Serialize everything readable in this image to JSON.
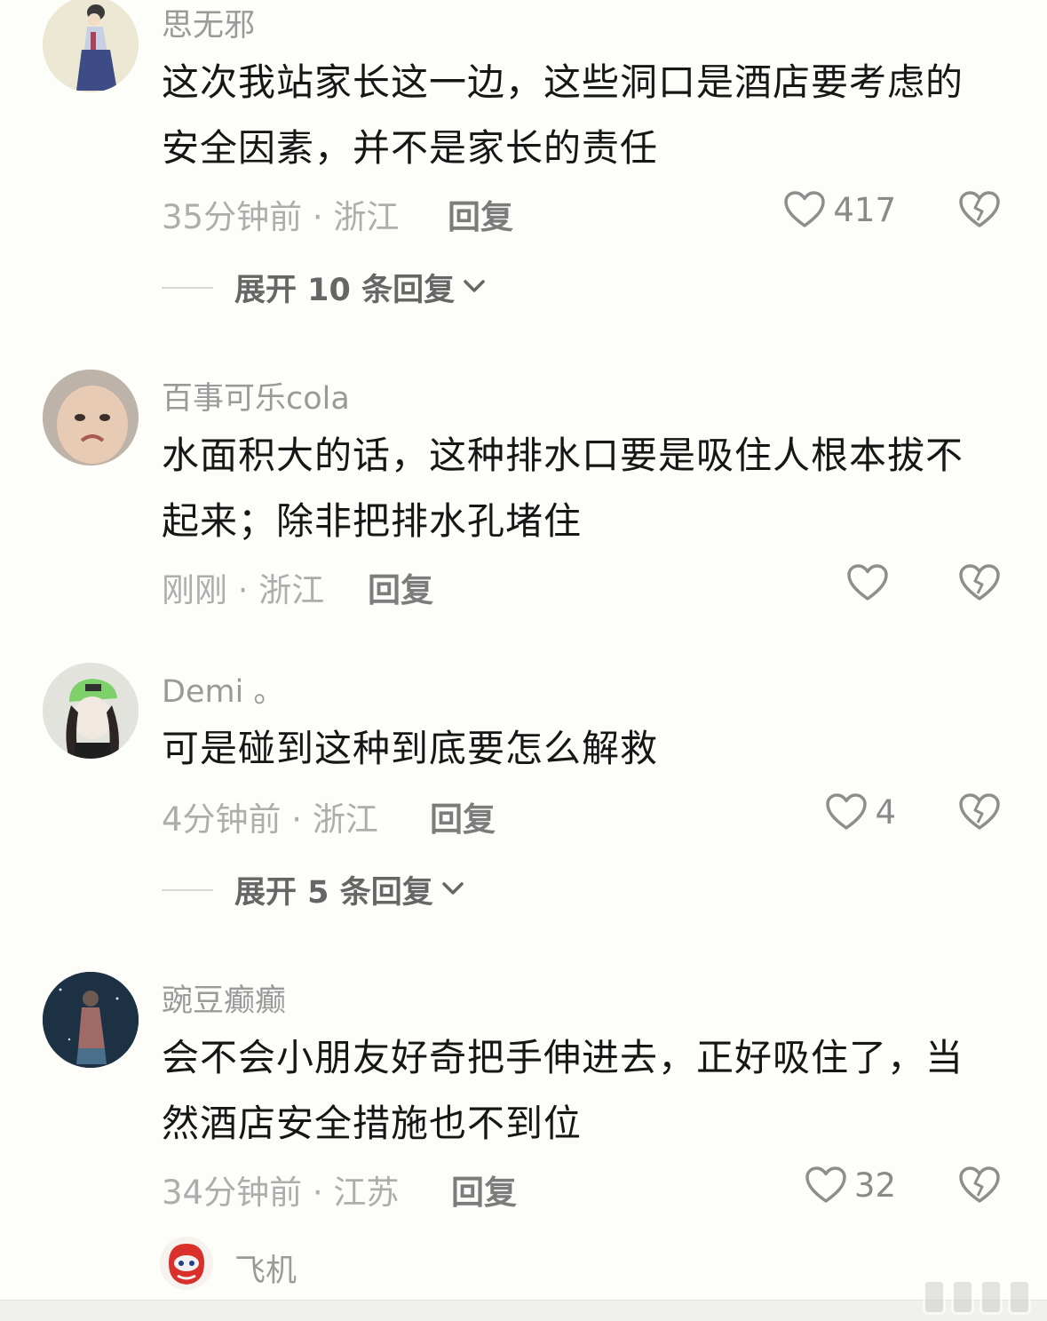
{
  "comments": [
    {
      "username": "思无邪",
      "text": "这次我站家长这一边，这些洞口是酒店要考虑的安全因素，并不是家长的责任",
      "meta": "35分钟前 · 浙江",
      "reply_label": "回复",
      "like_count": "417",
      "expand_label": "展开 10 条回复"
    },
    {
      "username": "百事可乐cola",
      "text": "水面积大的话，这种排水口要是吸住人根本拔不起来；除非把排水孔堵住",
      "meta": "刚刚 · 浙江",
      "reply_label": "回复",
      "like_count": ""
    },
    {
      "username": "Demi 。",
      "text": "可是碰到这种到底要怎么解救",
      "meta": "4分钟前 · 浙江",
      "reply_label": "回复",
      "like_count": "4",
      "expand_label": "展开 5 条回复"
    },
    {
      "username": "豌豆癫癫",
      "text": "会不会小朋友好奇把手伸进去，正好吸住了，当然酒店安全措施也不到位",
      "meta": "34分钟前 · 江苏",
      "reply_label": "回复",
      "like_count": "32"
    },
    {
      "username": "飞机"
    }
  ],
  "icons": {
    "like": "heart-outline-icon",
    "dislike": "broken-heart-icon",
    "expand": "chevron-down-icon"
  },
  "colors": {
    "background": "#fdfdfa",
    "username": "#9a9a9a",
    "meta": "#adadad",
    "text": "#161616"
  }
}
